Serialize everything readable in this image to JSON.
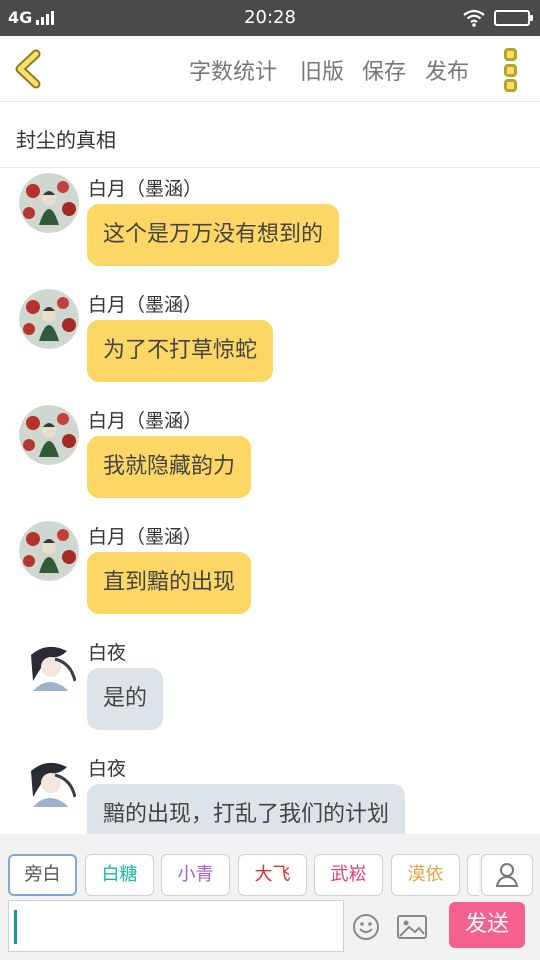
{
  "status_bar": {
    "network": "4G",
    "time": "20:28"
  },
  "toolbar": {
    "actions": [
      "字数统计",
      "旧版",
      "保存",
      "发布"
    ]
  },
  "title": "封尘的真相",
  "messages": [
    {
      "speaker": "白月（墨涵）",
      "text": "这个是万万没有想到的",
      "style": "yellow",
      "avatar": "avatar-baiyue"
    },
    {
      "speaker": "白月（墨涵）",
      "text": "为了不打草惊蛇",
      "style": "yellow",
      "avatar": "avatar-baiyue"
    },
    {
      "speaker": "白月（墨涵）",
      "text": "我就隐藏韵力",
      "style": "yellow",
      "avatar": "avatar-baiyue"
    },
    {
      "speaker": "白月（墨涵）",
      "text": "直到黯的出现",
      "style": "yellow",
      "avatar": "avatar-baiyue"
    },
    {
      "speaker": "白夜",
      "text": "是的",
      "style": "gray",
      "avatar": "avatar-baiye"
    },
    {
      "speaker": "白夜",
      "text": "黯的出现，打乱了我们的计划",
      "style": "gray",
      "avatar": "avatar-baiye"
    }
  ],
  "characters": [
    {
      "label": "旁白",
      "color": "#555555",
      "active": true
    },
    {
      "label": "白糖",
      "color": "#19b8a6"
    },
    {
      "label": "小青",
      "color": "#a25fd1"
    },
    {
      "label": "大飞",
      "color": "#d8342f"
    },
    {
      "label": "武崧",
      "color": "#e0417f"
    },
    {
      "label": "漠依",
      "color": "#e8a24a"
    }
  ],
  "composer": {
    "send_label": "发送",
    "input_value": ""
  },
  "colors": {
    "bubble_yellow": "#fcd765",
    "bubble_gray": "#dce4ea",
    "send_button": "#f4618e",
    "accent_yellow": "#f7e06b"
  }
}
